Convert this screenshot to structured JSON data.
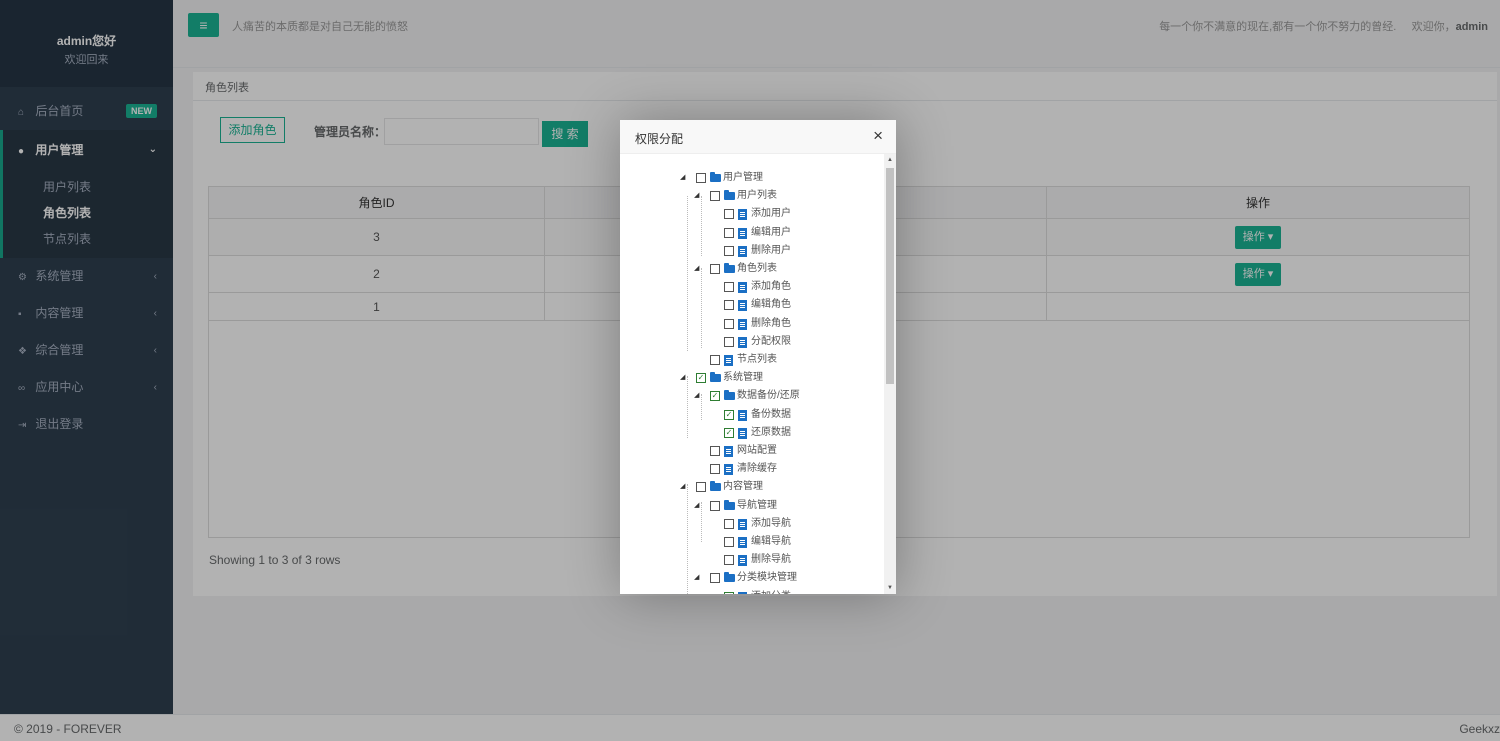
{
  "sidebar": {
    "user_name": "admin您好",
    "welcome": "欢迎回来",
    "home": {
      "label": "后台首页",
      "badge": "NEW"
    },
    "user_mgmt": {
      "label": "用户管理",
      "children": [
        "用户列表",
        "角色列表",
        "节点列表"
      ]
    },
    "system": "系统管理",
    "content": "内容管理",
    "general": "综合管理",
    "apps": "应用中心",
    "logout": "退出登录"
  },
  "topbar": {
    "quote": "人痛苦的本质都是对自己无能的愤怒",
    "motto": "每一个你不满意的现在,都有一个你不努力的曾经.",
    "welcome_prefix": "欢迎你，",
    "welcome_user": "admin"
  },
  "page": {
    "title": "角色列表",
    "add_button": "添加角色",
    "search_label": "管理员名称：",
    "search_value": "",
    "search_button": "搜 索",
    "table": {
      "headers": [
        "角色ID",
        "",
        "",
        "操作"
      ],
      "rows": [
        {
          "id": "3",
          "op": "操作"
        },
        {
          "id": "2",
          "op": "操作"
        },
        {
          "id": "1",
          "op": ""
        }
      ]
    },
    "showing": "Showing 1 to 3 of 3 rows"
  },
  "modal": {
    "title": "权限分配",
    "close": "×",
    "tree": [
      {
        "label": "用户管理",
        "type": "folder",
        "checked": false,
        "level": 0,
        "expanded": true
      },
      {
        "label": "用户列表",
        "type": "folder",
        "checked": false,
        "level": 1,
        "expanded": true
      },
      {
        "label": "添加用户",
        "type": "doc",
        "checked": false,
        "level": 2
      },
      {
        "label": "编辑用户",
        "type": "doc",
        "checked": false,
        "level": 2
      },
      {
        "label": "删除用户",
        "type": "doc",
        "checked": false,
        "level": 2
      },
      {
        "label": "角色列表",
        "type": "folder",
        "checked": false,
        "level": 1,
        "expanded": true
      },
      {
        "label": "添加角色",
        "type": "doc",
        "checked": false,
        "level": 2
      },
      {
        "label": "编辑角色",
        "type": "doc",
        "checked": false,
        "level": 2
      },
      {
        "label": "删除角色",
        "type": "doc",
        "checked": false,
        "level": 2
      },
      {
        "label": "分配权限",
        "type": "doc",
        "checked": false,
        "level": 2
      },
      {
        "label": "节点列表",
        "type": "doc",
        "checked": false,
        "level": 1
      },
      {
        "label": "系统管理",
        "type": "folder",
        "checked": true,
        "level": 0,
        "expanded": true
      },
      {
        "label": "数据备份/还原",
        "type": "folder",
        "checked": true,
        "level": 1,
        "expanded": true
      },
      {
        "label": "备份数据",
        "type": "doc",
        "checked": true,
        "level": 2
      },
      {
        "label": "还原数据",
        "type": "doc",
        "checked": true,
        "level": 2
      },
      {
        "label": "网站配置",
        "type": "doc",
        "checked": false,
        "level": 1
      },
      {
        "label": "清除缓存",
        "type": "doc",
        "checked": false,
        "level": 1
      },
      {
        "label": "内容管理",
        "type": "folder",
        "checked": false,
        "level": 0,
        "expanded": true
      },
      {
        "label": "导航管理",
        "type": "folder",
        "checked": false,
        "level": 1,
        "expanded": true
      },
      {
        "label": "添加导航",
        "type": "doc",
        "checked": false,
        "level": 2
      },
      {
        "label": "编辑导航",
        "type": "doc",
        "checked": false,
        "level": 2
      },
      {
        "label": "删除导航",
        "type": "doc",
        "checked": false,
        "level": 2
      },
      {
        "label": "分类模块管理",
        "type": "folder",
        "checked": false,
        "level": 1,
        "expanded": true
      },
      {
        "label": "添加分类",
        "type": "doc",
        "checked": true,
        "level": 2
      }
    ]
  },
  "footer": {
    "copyright": "© 2019 - FOREVER",
    "brand": "Geekxz"
  },
  "colors": {
    "accent": "#1ab394",
    "sidebar_bg": "#2f4050",
    "icon_blue": "#1b6fc4"
  }
}
